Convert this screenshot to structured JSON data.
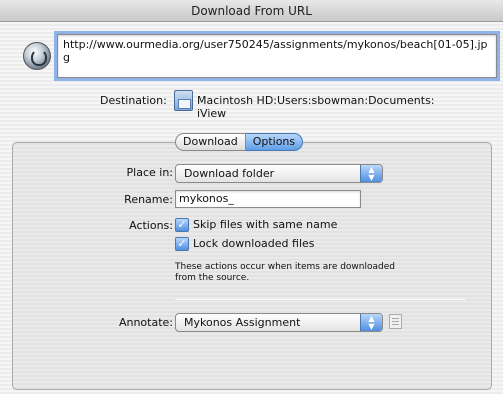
{
  "window": {
    "title": "Download From URL"
  },
  "url": {
    "value": "http://www.ourmedia.org/user750245/assignments/mykonos/beach[01-05].jpg"
  },
  "destination": {
    "label": "Destination:",
    "value": "Macintosh HD:Users:sbowman:Documents:\niView"
  },
  "tabs": [
    {
      "label": "Download",
      "active": false
    },
    {
      "label": "Options",
      "active": true
    }
  ],
  "options": {
    "place_in": {
      "label": "Place in:",
      "value": "Download folder"
    },
    "rename": {
      "label": "Rename:",
      "value": "mykonos_"
    },
    "actions": {
      "label": "Actions:",
      "skip": {
        "label": "Skip files with same name",
        "checked": true
      },
      "lock": {
        "label": "Lock downloaded files",
        "checked": true
      },
      "note": "These actions occur when items are downloaded from the source."
    },
    "annotate": {
      "label": "Annotate:",
      "value": "Mykonos Assignment"
    }
  },
  "icons": {
    "url": "globe-icon",
    "destination": "folder-icon",
    "popup": "updown-arrows-icon",
    "note": "note-icon"
  },
  "colors": {
    "accent": "#5f9ee8",
    "focus_ring": "#8fb3e8"
  }
}
